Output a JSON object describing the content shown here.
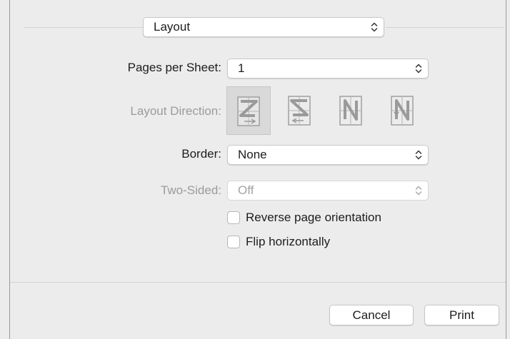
{
  "section_popup": {
    "value": "Layout"
  },
  "pages_per_sheet": {
    "label": "Pages per Sheet:",
    "value": "1"
  },
  "layout_direction": {
    "label": "Layout Direction:",
    "options": [
      {
        "icon": "z-order-icon",
        "selected": true
      },
      {
        "icon": "reverse-z-order-icon",
        "selected": false
      },
      {
        "icon": "reverse-n-order-icon",
        "selected": false
      },
      {
        "icon": "n-order-icon",
        "selected": false
      }
    ]
  },
  "border": {
    "label": "Border:",
    "value": "None"
  },
  "two_sided": {
    "label": "Two-Sided:",
    "value": "Off"
  },
  "reverse_orientation": {
    "label": "Reverse page orientation",
    "checked": false
  },
  "flip_horizontally": {
    "label": "Flip horizontally",
    "checked": false
  },
  "buttons": {
    "cancel": "Cancel",
    "print": "Print"
  },
  "colors": {
    "background": "#ececec",
    "disabled_text": "#9b9b9b",
    "icon_disabled": "#a0a0a0"
  }
}
